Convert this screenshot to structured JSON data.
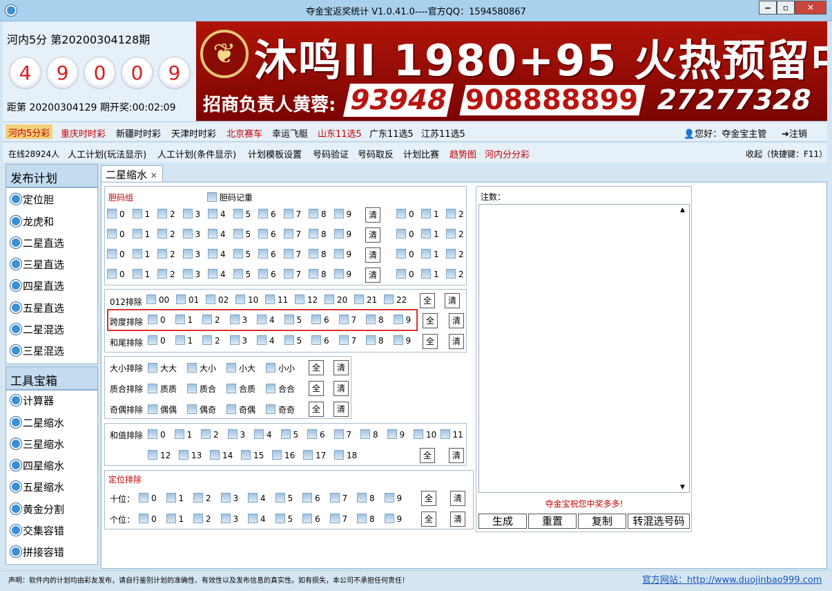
{
  "window": {
    "title": "夺金宝返奖统计  V1.0.41.0----官方QQ：1594580867",
    "min": "‒",
    "max": "▫",
    "close": "✕"
  },
  "header": {
    "game": "河内5分  第20200304128期",
    "balls": [
      "4",
      "9",
      "0",
      "0",
      "9"
    ],
    "countdown": "距第 20200304129 期开奖:00:02:09"
  },
  "banner": {
    "logo": "❦",
    "title": "沐鸣II 1980+95 火热预留中",
    "sub": "招商负责人黄蓉:",
    "phones": [
      "93948",
      "908888899",
      "27277328"
    ]
  },
  "nav1": {
    "items": [
      "河内5分彩",
      "重庆时时彩",
      "新疆时时彩",
      "天津时时彩",
      "北京赛车",
      "幸运飞艇",
      "山东11选5",
      "广东11选5",
      "江苏11选5"
    ],
    "greeting": "您好：夺金宝主管",
    "logout": "注销"
  },
  "nav2": {
    "online": "在线28924人",
    "items": [
      "人工计划(玩法显示)",
      "人工计划(条件显示)",
      "计划模板设置",
      "号码验证",
      "号码取反",
      "计划比赛",
      "趋势图",
      "河内分分彩"
    ],
    "collapse": "收起（快捷键：F11）"
  },
  "sidebar": {
    "publish_title": "发布计划",
    "publish_items": [
      "定位胆",
      "龙虎和",
      "二星直选",
      "三星直选",
      "四星直选",
      "五星直选",
      "二星混选",
      "三星混选"
    ],
    "tools_title": "工具宝箱",
    "tools_items": [
      "计算器",
      "二星缩水",
      "三星缩水",
      "四星缩水",
      "五星缩水",
      "黄金分割",
      "交集容错",
      "拼接容错"
    ]
  },
  "tab": {
    "label": "二星缩水",
    "close": "✕"
  },
  "dan": {
    "title": "胆码组",
    "repeat": "胆码记重",
    "digits": [
      "0",
      "1",
      "2",
      "3",
      "4",
      "5",
      "6",
      "7",
      "8",
      "9"
    ],
    "right_digits": [
      "0",
      "1",
      "2"
    ],
    "clear": "清"
  },
  "excl": {
    "r012_label": "012排除",
    "r012_opts": [
      "00",
      "01",
      "02",
      "10",
      "11",
      "12",
      "20",
      "21",
      "22"
    ],
    "span_label": "跨度排除",
    "tail_label": "和尾排除",
    "digits": [
      "0",
      "1",
      "2",
      "3",
      "4",
      "5",
      "6",
      "7",
      "8",
      "9"
    ],
    "all": "全",
    "clear": "清"
  },
  "prop": {
    "size_label": "大小排除",
    "size_opts": [
      "大大",
      "大小",
      "小大",
      "小小"
    ],
    "prime_label": "质合排除",
    "prime_opts": [
      "质质",
      "质合",
      "合质",
      "合合"
    ],
    "odd_label": "奇偶排除",
    "odd_opts": [
      "偶偶",
      "偶奇",
      "奇偶",
      "奇奇"
    ]
  },
  "sum": {
    "label": "和值排除",
    "row1": [
      "0",
      "1",
      "2",
      "3",
      "4",
      "5",
      "6",
      "7",
      "8",
      "9",
      "10",
      "11"
    ],
    "row2": [
      "12",
      "13",
      "14",
      "15",
      "16",
      "17",
      "18"
    ]
  },
  "pos": {
    "title": "定位排除",
    "tens": "十位：",
    "units": "个位："
  },
  "result": {
    "label": "注数：",
    "wish": "夺金宝祝您中奖多多!",
    "buttons": [
      "生成",
      "重置",
      "复制",
      "转混选号码"
    ]
  },
  "status": {
    "disclaimer": "声明：软件内的计划均由彩友发布，请自行鉴别计划的准确性、有效性以及发布信息的真实性。如有损失，本公司不承担任何责任！",
    "site": "官方网站：http://www.duojinbao999.com"
  },
  "colors": {
    "accent": "#c40000",
    "frame": "#a9d1ee",
    "highlight": "#d9322b"
  }
}
